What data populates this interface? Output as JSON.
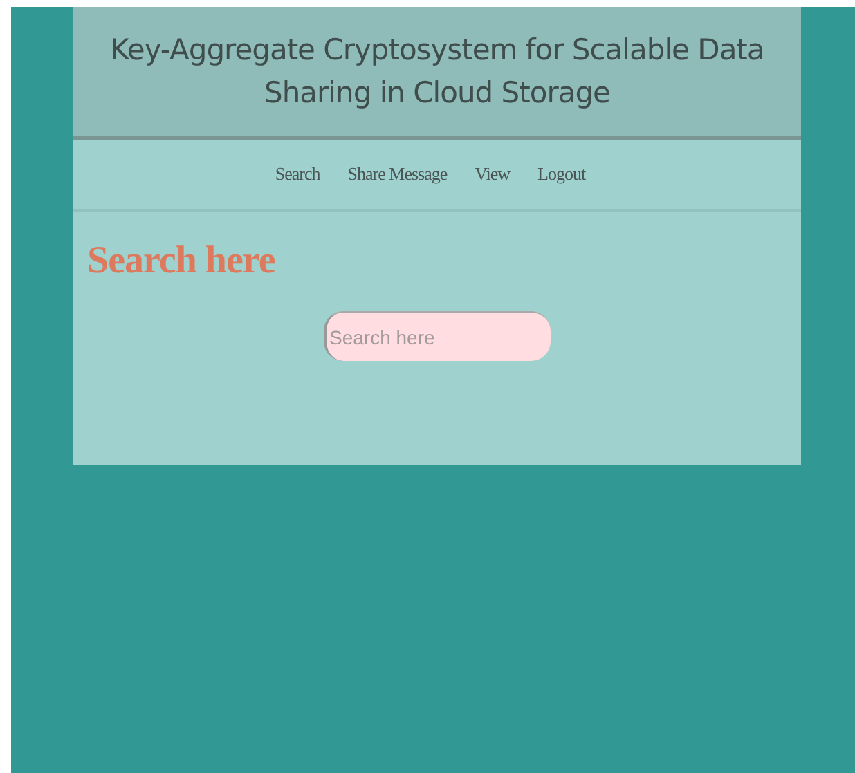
{
  "header": {
    "title": "Key-Aggregate Cryptosystem for Scalable Data Sharing in Cloud Storage"
  },
  "nav": {
    "items": [
      {
        "label": "Search"
      },
      {
        "label": "Share Message"
      },
      {
        "label": "View"
      },
      {
        "label": "Logout"
      }
    ]
  },
  "content": {
    "heading": "Search here",
    "search": {
      "placeholder": "Search here"
    }
  }
}
